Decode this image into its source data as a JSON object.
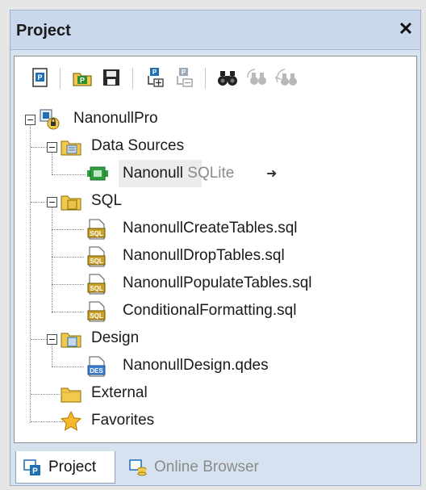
{
  "window": {
    "title": "Project",
    "close_glyph": "✕"
  },
  "toolbar": {
    "buttons": [
      "new-project-icon",
      "open-project-icon",
      "save-project-icon",
      "add-connection-icon",
      "remove-connection-icon",
      "find-icon",
      "find-next-icon",
      "replace-icon"
    ]
  },
  "tree": {
    "root": {
      "label": "NanonullPro",
      "icon": "project-root-icon"
    },
    "data_sources": {
      "label": "Data Sources"
    },
    "connection": {
      "name": "Nanonull",
      "type": "SQLite",
      "arrow": "➜"
    },
    "sql": {
      "label": "SQL"
    },
    "sql_files": [
      "NanonullCreateTables.sql",
      "NanonullDropTables.sql",
      "NanonullPopulateTables.sql",
      "ConditionalFormatting.sql"
    ],
    "design": {
      "label": "Design"
    },
    "design_file": "NanonullDesign.qdes",
    "external": {
      "label": "External"
    },
    "favorites": {
      "label": "Favorites"
    }
  },
  "tabs": [
    {
      "label": "Project",
      "active": true
    },
    {
      "label": "Online Browser",
      "active": false
    }
  ],
  "colors": {
    "title_bg": "#c9d8ec",
    "folder": "#f3c94d",
    "sql_badge": "#8a6d00",
    "connection_green": "#2f9e3c"
  }
}
